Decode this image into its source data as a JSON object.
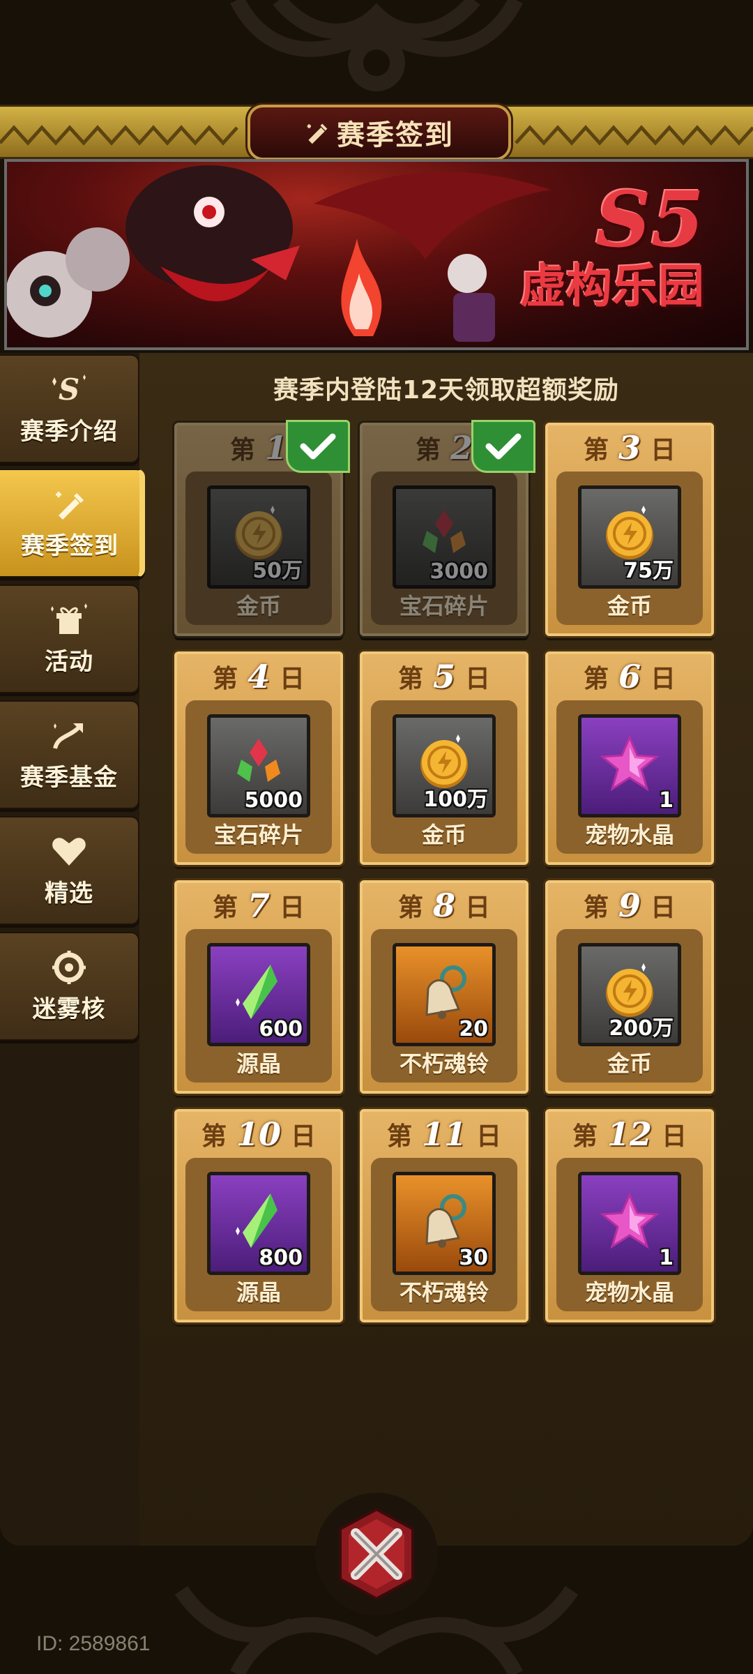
{
  "header": {
    "title": "赛季签到"
  },
  "banner": {
    "season_code": "S5",
    "season_name": "虚构乐园"
  },
  "sidebar": {
    "items": [
      {
        "label": "赛季介绍",
        "icon": "season-s-icon",
        "active": false
      },
      {
        "label": "赛季签到",
        "icon": "checkin-pen-icon",
        "active": true
      },
      {
        "label": "活动",
        "icon": "gift-box-icon",
        "active": false
      },
      {
        "label": "赛季基金",
        "icon": "fund-arrow-icon",
        "active": false
      },
      {
        "label": "精选",
        "icon": "heart-icon",
        "active": false
      },
      {
        "label": "迷雾核",
        "icon": "fog-core-icon",
        "active": false
      }
    ]
  },
  "main": {
    "subtitle": "赛季内登陆12天领取超额奖励",
    "day_prefix": "第",
    "day_suffix": "日",
    "rewards": [
      {
        "day": "1",
        "name": "金币",
        "qty": "50万",
        "icon": "gold-coin-icon",
        "frame": "grey",
        "claimed": true
      },
      {
        "day": "2",
        "name": "宝石碎片",
        "qty": "3000",
        "icon": "gem-shard-icon",
        "frame": "grey",
        "claimed": true
      },
      {
        "day": "3",
        "name": "金币",
        "qty": "75万",
        "icon": "gold-coin-icon",
        "frame": "grey",
        "claimed": false
      },
      {
        "day": "4",
        "name": "宝石碎片",
        "qty": "5000",
        "icon": "gem-shard-icon",
        "frame": "grey",
        "claimed": false
      },
      {
        "day": "5",
        "name": "金币",
        "qty": "100万",
        "icon": "gold-coin-icon",
        "frame": "grey",
        "claimed": false
      },
      {
        "day": "6",
        "name": "宠物水晶",
        "qty": "1",
        "icon": "pet-crystal-star-icon",
        "frame": "purple",
        "claimed": false
      },
      {
        "day": "7",
        "name": "源晶",
        "qty": "600",
        "icon": "source-crystal-icon",
        "frame": "purple",
        "claimed": false
      },
      {
        "day": "8",
        "name": "不朽魂铃",
        "qty": "20",
        "icon": "soul-bell-icon",
        "frame": "orange",
        "claimed": false
      },
      {
        "day": "9",
        "name": "金币",
        "qty": "200万",
        "icon": "gold-coin-icon",
        "frame": "grey",
        "claimed": false
      },
      {
        "day": "10",
        "name": "源晶",
        "qty": "800",
        "icon": "source-crystal-icon",
        "frame": "purple",
        "claimed": false
      },
      {
        "day": "11",
        "name": "不朽魂铃",
        "qty": "30",
        "icon": "soul-bell-icon",
        "frame": "orange",
        "claimed": false
      },
      {
        "day": "12",
        "name": "宠物水晶",
        "qty": "1",
        "icon": "pet-crystal-star-icon",
        "frame": "purple",
        "claimed": false
      }
    ]
  },
  "footer": {
    "id_text": "ID: 2589861"
  },
  "colors": {
    "accent_gold": "#f4c74d",
    "claimed_green": "#2f8f34",
    "banner_red": "#e73b44"
  }
}
